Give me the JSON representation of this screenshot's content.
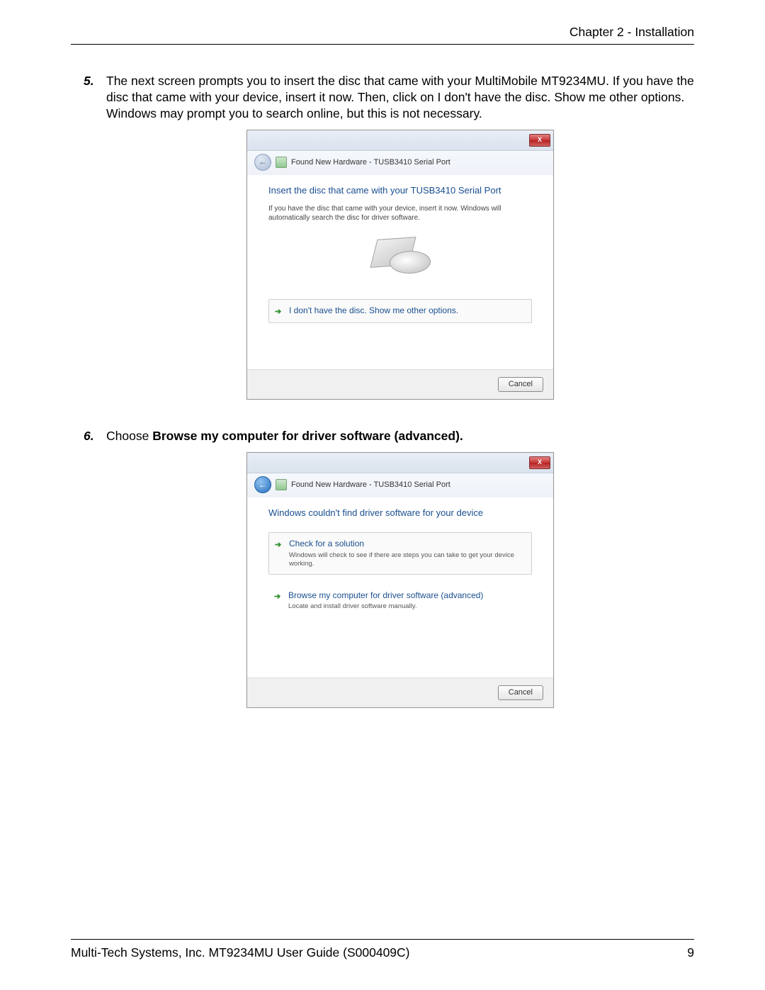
{
  "header": {
    "chapter": "Chapter 2 - Installation"
  },
  "footer": {
    "guide": "Multi-Tech Systems, Inc. MT9234MU User Guide (S000409C)",
    "page": "9"
  },
  "steps": {
    "s5": {
      "num": "5.",
      "text": "The next screen prompts you to insert the disc that came with your MultiMobile MT9234MU. If you have the disc that came with your device, insert it now. Then, click on I don't have the disc. Show me other options. Windows may prompt you to search online, but this is not necessary."
    },
    "s6": {
      "num": "6.",
      "prefix": "Choose ",
      "bold": "Browse my computer for driver software (advanced)."
    }
  },
  "dialog1": {
    "nav_title": "Found New Hardware - TUSB3410 Serial Port",
    "heading": "Insert the disc that came with your TUSB3410 Serial Port",
    "text": "If you have the disc that came with your device, insert it now.  Windows will automatically search the disc for driver software.",
    "option": "I don't have the disc. Show me other options.",
    "cancel": "Cancel",
    "close": "X"
  },
  "dialog2": {
    "nav_title": "Found New Hardware - TUSB3410 Serial Port",
    "heading": "Windows couldn't find driver software for your device",
    "opt1_title": "Check for a solution",
    "opt1_sub": "Windows will check to see if there are steps you can take to get your device working.",
    "opt2_title": "Browse my computer for driver software (advanced)",
    "opt2_sub": "Locate and install driver software manually.",
    "cancel": "Cancel",
    "close": "X"
  }
}
